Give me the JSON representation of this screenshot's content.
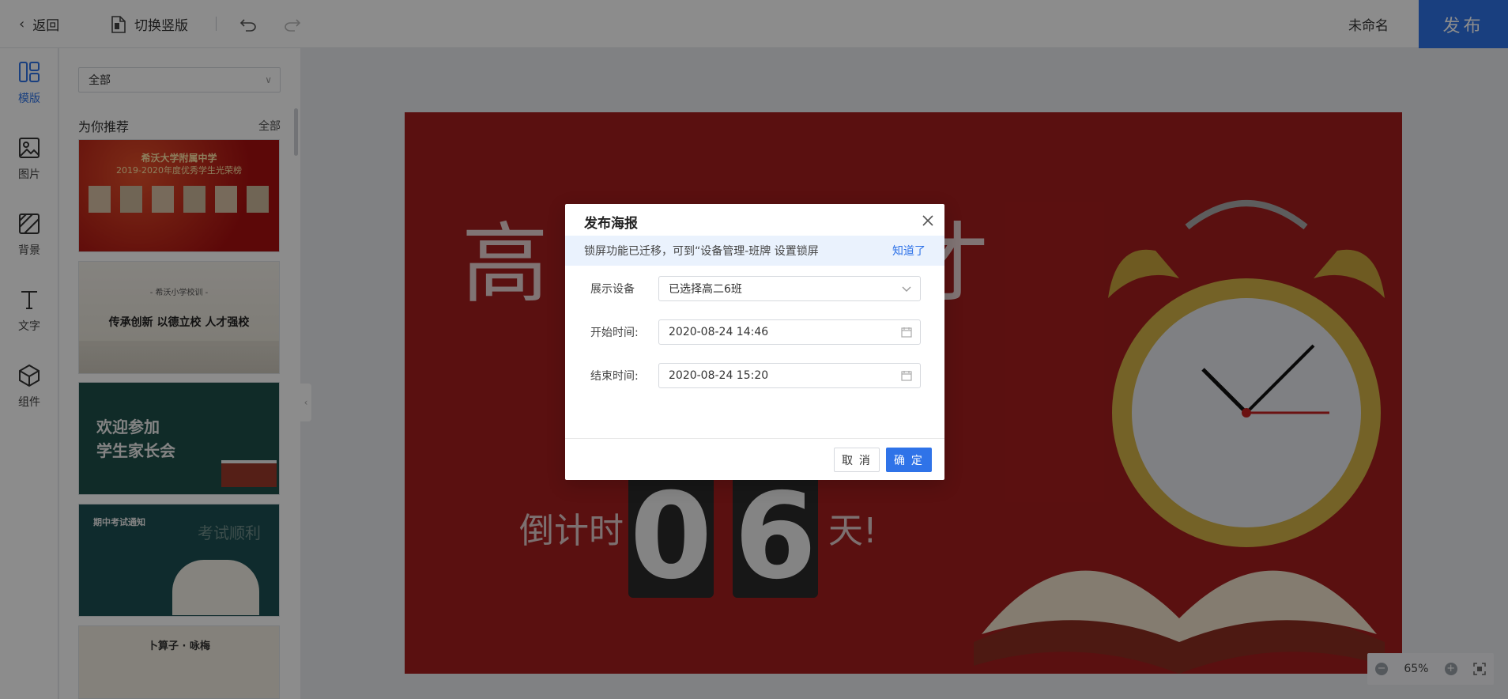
{
  "topbar": {
    "back_label": "返回",
    "switch_label": "切换竖版",
    "doc_name": "未命名",
    "publish_label": "发布"
  },
  "rail": {
    "items": [
      {
        "label": "模版",
        "icon": "template-icon",
        "active": true
      },
      {
        "label": "图片",
        "icon": "image-icon",
        "active": false
      },
      {
        "label": "背景",
        "icon": "background-icon",
        "active": false
      },
      {
        "label": "文字",
        "icon": "text-icon",
        "active": false
      },
      {
        "label": "组件",
        "icon": "component-icon",
        "active": false
      }
    ]
  },
  "panel": {
    "filter_value": "全部",
    "section_title": "为你推荐",
    "section_all": "全部",
    "thumbnails": [
      {
        "line1": "希沃大学附属中学",
        "line2": "2019-2020年度优秀学生光荣榜"
      },
      {
        "line1": "- 希沃小学校训 -",
        "line2": "传承创新  以德立校  人才强校"
      },
      {
        "line1": "欢迎参加",
        "line2": "学生家长会"
      },
      {
        "line1": "期中考试通知",
        "line2": "考试顺利"
      },
      {
        "line1": "卜算子 · 咏梅",
        "line2": ""
      }
    ]
  },
  "poster": {
    "title_left": "高",
    "title_right": "才",
    "countdown_prefix": "倒计时",
    "digit1": "0",
    "digit2": "6",
    "countdown_suffix": "天!"
  },
  "modal": {
    "title": "发布海报",
    "notice_text": "锁屏功能已迁移，可到“设备管理-班牌 设置锁屏",
    "notice_link": "知道了",
    "device_label": "展示设备",
    "device_value": "已选择高二6班",
    "start_label": "开始时间:",
    "start_value": "2020-08-24 14:46",
    "end_label": "结束时间:",
    "end_value": "2020-08-24 15:20",
    "cancel_label": "取 消",
    "ok_label": "确 定"
  },
  "zoom": {
    "level": "65%"
  },
  "colors": {
    "accent": "#2f73e8",
    "poster_bg": "#a51e1e"
  }
}
